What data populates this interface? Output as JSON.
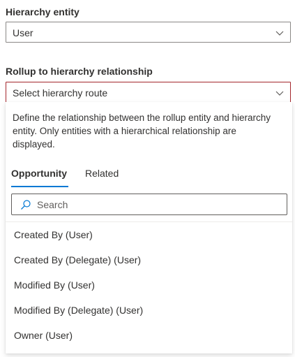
{
  "hierarchy_entity": {
    "label": "Hierarchy entity",
    "value": "User"
  },
  "rollup_relationship": {
    "label": "Rollup to hierarchy relationship",
    "value": "Select hierarchy route",
    "invalid_border_color": "#a4262c"
  },
  "panel": {
    "description": "Define the relationship between the rollup entity and hierarchy entity. Only entities with a hierarchical relationship are displayed.",
    "tabs": [
      {
        "label": "Opportunity",
        "selected": true
      },
      {
        "label": "Related",
        "selected": false
      }
    ],
    "search": {
      "placeholder": "Search",
      "value": "",
      "icon": "search-icon"
    },
    "items": [
      "Created By (User)",
      "Created By (Delegate) (User)",
      "Modified By (User)",
      "Modified By (Delegate) (User)",
      "Owner (User)"
    ]
  },
  "colors": {
    "accent": "#0078d4",
    "text": "#323130",
    "border": "#8a8886"
  },
  "icons": {
    "dropdown": "chevron-down-icon"
  }
}
